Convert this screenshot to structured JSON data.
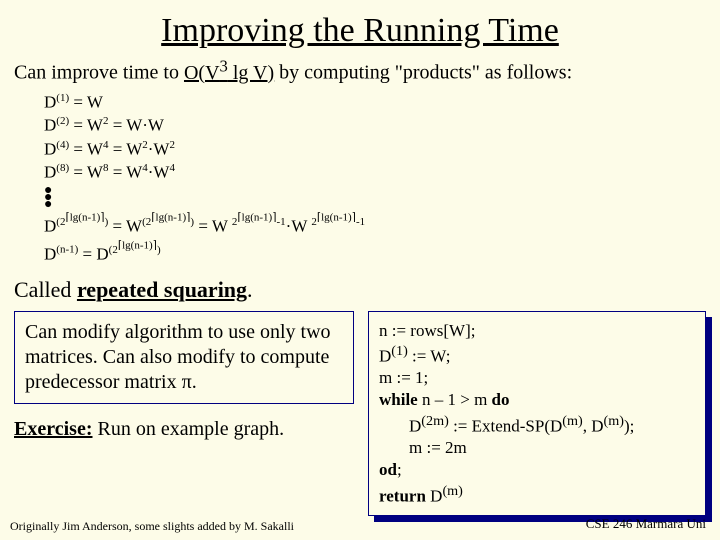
{
  "title": "Improving the Running Time",
  "subtitle_pre": "Can improve time to ",
  "subtitle_mid": "O(V",
  "subtitle_exp": "3",
  "subtitle_post": " lg V)",
  "subtitle_tail": " by computing \"products\" as follows:",
  "eq1_a": "D",
  "eq1_sup": "(1)",
  "eq1_b": " = W",
  "eq2_a": "D",
  "eq2_sup": "(2)",
  "eq2_b": " = W",
  "eq2_sup2": "2",
  "eq2_c": " = W·W",
  "eq3_a": "D",
  "eq3_sup": "(4)",
  "eq3_b": " = W",
  "eq3_sup2": "4",
  "eq3_c": " = W",
  "eq3_sup3": "2",
  "eq3_d": "·W",
  "eq3_sup4": "2",
  "eq4_a": "D",
  "eq4_sup": "(8)",
  "eq4_b": " = W",
  "eq4_sup2": "8",
  "eq4_c": " = W",
  "eq4_sup3": "4",
  "eq4_d": "·W",
  "eq4_sup4": "4",
  "eq5_a": "D",
  "eq5_sup1": "(2",
  "eq5_sup2": "⌈lg(n-1)⌉",
  "eq5_sup3": ")",
  "eq5_b": " = W",
  "eq5_sup4": "(2",
  "eq5_sup5": "⌈lg(n-1)⌉",
  "eq5_sup6": ")",
  "eq5_c": " = W ",
  "eq5_sup7": "2",
  "eq5_sup8": "⌈lg(n-1)⌉",
  "eq5_sup9": "-1",
  "eq5_d": "·W ",
  "eq5_sup10": "2",
  "eq5_sup11": "⌈lg(n-1)⌉",
  "eq5_sup12": "-1",
  "eq6_a": "D",
  "eq6_sup1": "(n-1)",
  "eq6_b": " = D",
  "eq6_sup2": "(2",
  "eq6_sup3": "⌈lg(n-1)⌉",
  "eq6_sup4": ")",
  "called_pre": "Called ",
  "called_term": "repeated squaring",
  "called_post": ".",
  "box1_text": "Can modify algorithm to use only two matrices. Can also modify to compute predecessor matrix π.",
  "exercise_label": "Exercise:",
  "exercise_text": " Run on example graph.",
  "code": {
    "l1": "n := rows[W];",
    "l2a": "D",
    "l2sup": "(1)",
    "l2b": " := W;",
    "l3": "m := 1;",
    "l4pre": "while",
    "l4mid": " n – 1 > m ",
    "l4post": "do",
    "l5a": "D",
    "l5sup1": "(2m)",
    "l5b": " := Extend-SP(D",
    "l5sup2": "(m)",
    "l5c": ", D",
    "l5sup3": "(m)",
    "l5d": ");",
    "l6": "m := 2m",
    "l7": "od",
    "l8a": "return",
    "l8b": " D",
    "l8sup": "(m)"
  },
  "footer_left": "Originally Jim Anderson, some slights added by M. Sakalli",
  "footer_right": "CSE 246 Marmara Uni"
}
